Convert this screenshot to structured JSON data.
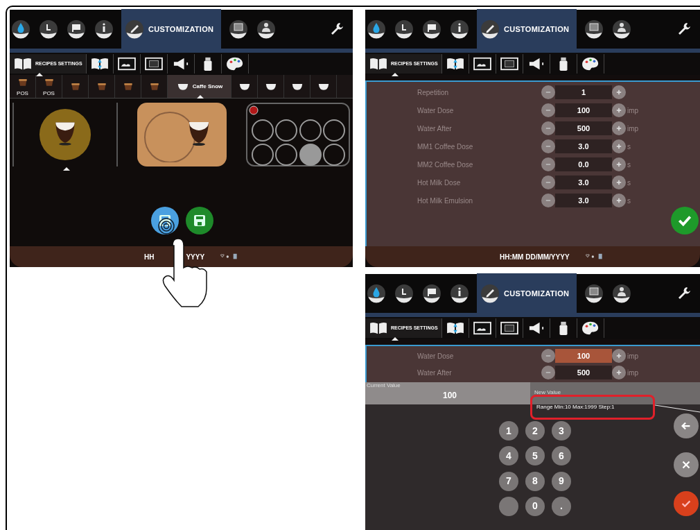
{
  "screens": [
    {
      "kind": "recipes",
      "top_tabs": [
        {
          "selected": false
        },
        {
          "selected": false
        },
        {
          "selected": false
        },
        {
          "selected": false
        },
        {
          "label": "CUSTOMIZATION",
          "selected": true
        },
        {
          "selected": false
        },
        {
          "selected": false
        },
        {
          "selected": false
        }
      ],
      "sub_tabs": [
        {
          "label": "RECIPES SETTINGS",
          "selected": true
        },
        {
          "selected": false
        },
        {
          "selected": false
        },
        {
          "selected": false
        },
        {
          "selected": false
        },
        {
          "selected": false
        },
        {
          "selected": false
        }
      ],
      "drinks": [
        {
          "label": "POS",
          "selected": false
        },
        {
          "label": "POS",
          "selected": false
        },
        {
          "selected": false
        },
        {
          "selected": false
        },
        {
          "selected": false
        },
        {
          "selected": false
        },
        {
          "label": "Caffe Snow",
          "selected": true
        },
        {
          "selected": false
        },
        {
          "selected": false
        },
        {
          "selected": false
        },
        {
          "selected": false
        }
      ],
      "slots": [
        {
          "selected": false
        },
        {
          "selected": false
        },
        {
          "selected": false
        },
        {
          "selected": false
        },
        {
          "selected": false
        },
        {
          "selected": false
        },
        {
          "selected": true
        },
        {
          "selected": false
        }
      ],
      "actions": [
        {
          "kind": "edit",
          "pressed": true
        },
        {
          "kind": "save",
          "pressed": false
        }
      ],
      "status": [
        "HH",
        "YYYY"
      ]
    },
    {
      "kind": "parameters",
      "top_tabs": [
        {
          "selected": false
        },
        {
          "selected": false
        },
        {
          "selected": false
        },
        {
          "selected": false
        },
        {
          "label": "CUSTOMIZATION",
          "selected": true
        },
        {
          "selected": false
        },
        {
          "selected": false
        },
        {
          "selected": false
        }
      ],
      "sub_tabs": [
        {
          "label": "RECIPES SETTINGS",
          "selected": true
        },
        {
          "selected": false
        },
        {
          "selected": false
        },
        {
          "selected": false
        },
        {
          "selected": false
        },
        {
          "selected": false
        },
        {
          "selected": false
        }
      ],
      "params": [
        {
          "name": "Repetition",
          "value": "1",
          "selected": false
        },
        {
          "name": "Water Dose",
          "value": "100",
          "unit": "imp",
          "selected": false
        },
        {
          "name": "Water After",
          "value": "500",
          "unit": "imp",
          "selected": false
        },
        {
          "name": "MM1 Coffee Dose",
          "value": "3.0",
          "unit": "s",
          "selected": false
        },
        {
          "name": "MM2 Coffee Dose",
          "value": "0.0",
          "unit": "s",
          "selected": false
        },
        {
          "name": "Hot Milk Dose",
          "value": "3.0",
          "unit": "s",
          "selected": false
        },
        {
          "name": "Hot Milk Emulsion",
          "value": "3.0",
          "unit": "s",
          "selected": false
        }
      ],
      "status": [
        "HH:MM DD/MM/YYYY"
      ]
    },
    {
      "kind": "keypad",
      "top_tabs": [
        {
          "selected": false
        },
        {
          "selected": false
        },
        {
          "selected": false
        },
        {
          "selected": false
        },
        {
          "label": "CUSTOMIZATION",
          "selected": true
        },
        {
          "selected": false
        },
        {
          "selected": false
        },
        {
          "selected": false
        }
      ],
      "sub_tabs": [
        {
          "label": "RECIPES SETTINGS",
          "selected": true
        },
        {
          "selected": false
        },
        {
          "selected": false
        },
        {
          "selected": false
        },
        {
          "selected": false
        },
        {
          "selected": false
        },
        {
          "selected": false
        }
      ],
      "params": [
        {
          "name": "Water Dose",
          "value": "100",
          "unit": "imp",
          "selected": true
        },
        {
          "name": "Water After",
          "value": "500",
          "unit": "imp",
          "selected": false
        }
      ],
      "keypad": {
        "current_label": "Current Value",
        "current_value": "100",
        "new_label": "New Value",
        "range": "Range Min:10 Max:1999 Step:1",
        "keys": [
          "1",
          "2",
          "3",
          "4",
          "5",
          "6",
          "7",
          "8",
          "9",
          "0",
          "."
        ]
      }
    }
  ]
}
